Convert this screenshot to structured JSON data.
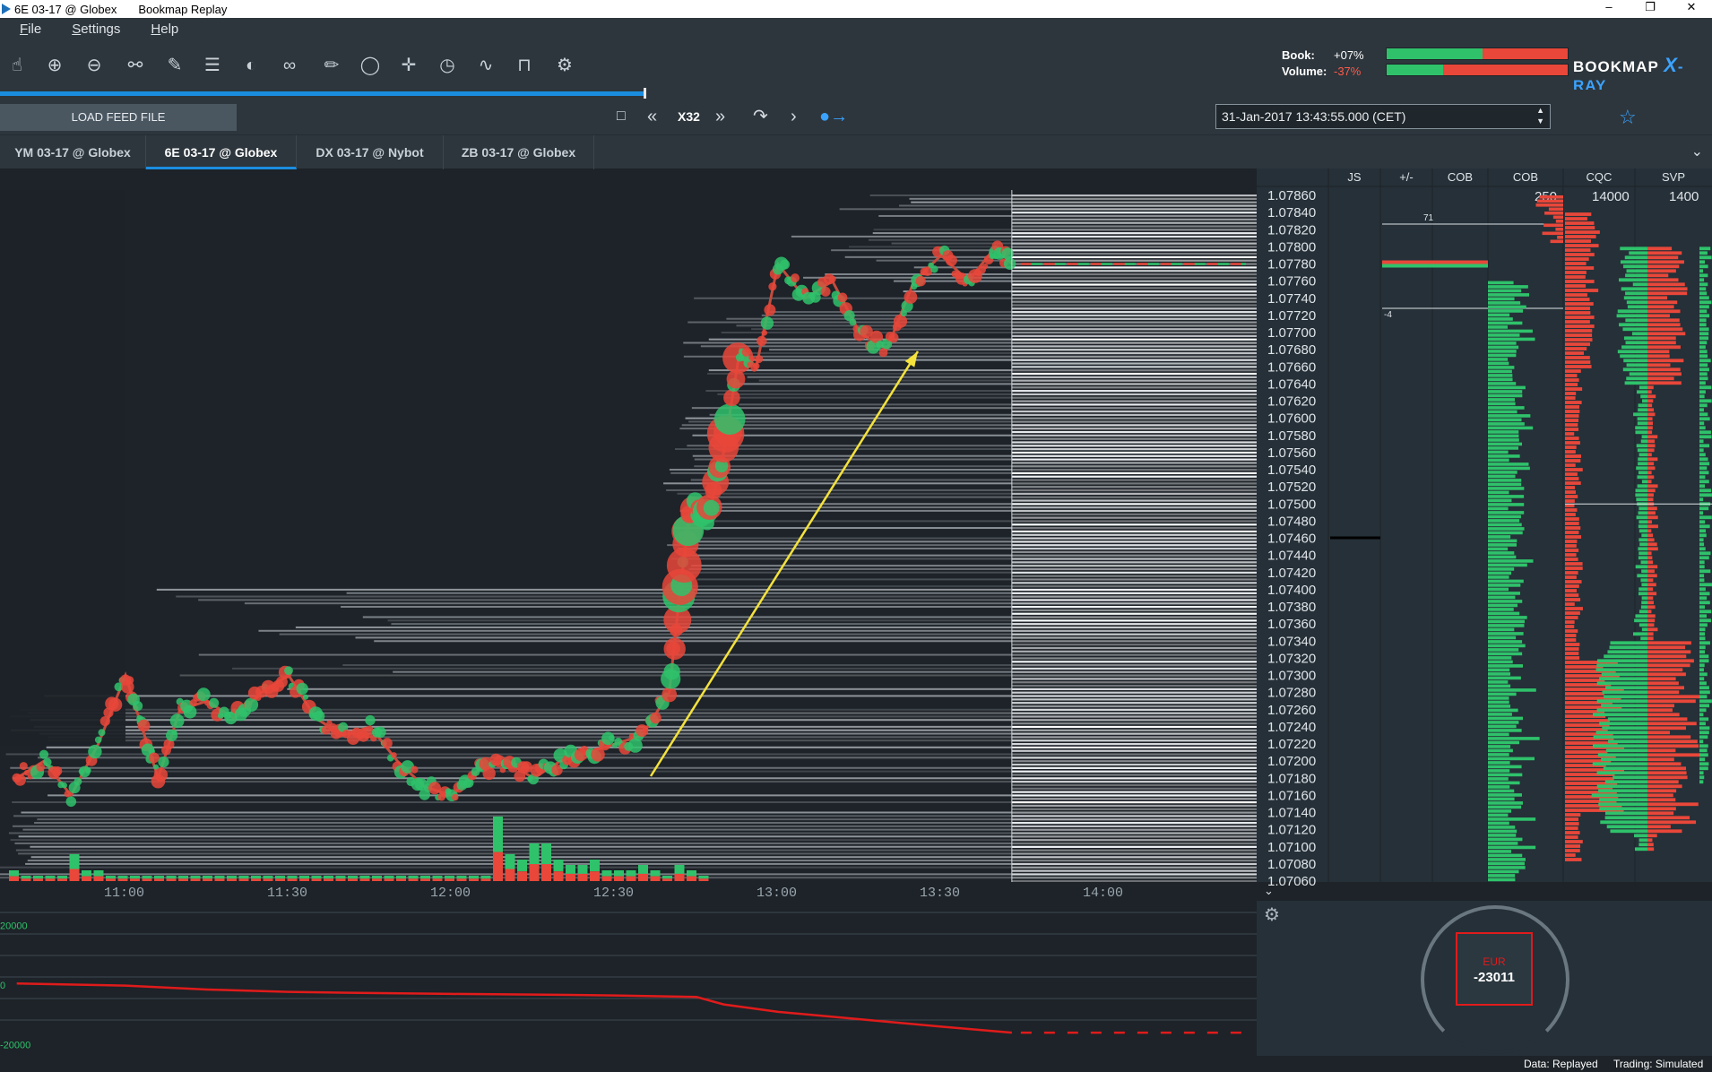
{
  "window": {
    "title": "6E 03-17 @ Globex",
    "app_name": "Bookmap Replay",
    "controls": [
      "–",
      "❐",
      "✕"
    ]
  },
  "menu": [
    "File",
    "Settings",
    "Help"
  ],
  "toolbar": {
    "icons": [
      "hand-icon",
      "zoom-in-icon",
      "zoom-out-icon",
      "share-icon",
      "probe-icon",
      "layers-icon",
      "brightness-icon",
      "link-icon",
      "pencil-icon",
      "chat-icon",
      "crosshair-icon",
      "stopwatch-icon",
      "strategy-icon",
      "lock-icon",
      "gear-icon"
    ],
    "book_label": "Book:",
    "book_value": "+07%",
    "volume_label": "Volume:",
    "volume_value": "-37%",
    "logo_text": "BOOKMAP",
    "logo_x": "X",
    "logo_ray": "-RAY",
    "colors": {
      "green": "#2fc26b",
      "red": "#e8473a",
      "blue": "#3aa3ff"
    }
  },
  "replay": {
    "progress": 0.377,
    "load_button": "LOAD FEED FILE",
    "speed": "X32",
    "datetime": "31-Jan-2017 13:43:55.000 (CET)"
  },
  "tabs": [
    {
      "label": "YM 03-17 @ Globex",
      "active": false
    },
    {
      "label": "6E 03-17 @ Globex",
      "active": true
    },
    {
      "label": "DX 03-17 @ Nybot",
      "active": false
    },
    {
      "label": "ZB 03-17 @ Globex",
      "active": false
    }
  ],
  "columns": {
    "headers": [
      "JS",
      "+/-",
      "COB",
      "COB",
      "CQC",
      "SVP"
    ],
    "scale_values": [
      "250",
      "14000",
      "1400"
    ],
    "cob_marks": [
      "71",
      "-4"
    ]
  },
  "chart_data": [
    {
      "type": "line",
      "title": "",
      "price_axis": [
        "1.07860",
        "1.07840",
        "1.07820",
        "1.07800",
        "1.07780",
        "1.07760",
        "1.07740",
        "1.07720",
        "1.07700",
        "1.07680",
        "1.07660",
        "1.07640",
        "1.07620",
        "1.07600",
        "1.07580",
        "1.07560",
        "1.07540",
        "1.07520",
        "1.07500",
        "1.07480",
        "1.07460",
        "1.07440",
        "1.07420",
        "1.07400",
        "1.07380",
        "1.07360",
        "1.07340",
        "1.07320",
        "1.07300",
        "1.07280",
        "1.07260",
        "1.07240",
        "1.07220",
        "1.07200",
        "1.07180",
        "1.07160",
        "1.07140",
        "1.07120",
        "1.07100",
        "1.07080",
        "1.07060"
      ],
      "time_axis": [
        "11:00",
        "11:30",
        "12:00",
        "12:30",
        "13:00",
        "13:30",
        "14:00"
      ],
      "ylim": [
        1.0706,
        1.0786
      ],
      "series": [
        {
          "values": [
            [
              "10:40",
              1.0718
            ],
            [
              "10:45",
              1.072
            ],
            [
              "10:50",
              1.0716
            ],
            [
              "10:55",
              1.0722
            ],
            [
              "11:00",
              1.073
            ],
            [
              "11:03",
              1.0724
            ],
            [
              "11:06",
              1.0718
            ],
            [
              "11:10",
              1.0726
            ],
            [
              "11:15",
              1.0727
            ],
            [
              "11:20",
              1.0725
            ],
            [
              "11:25",
              1.0728
            ],
            [
              "11:30",
              1.073
            ],
            [
              "11:35",
              1.0725
            ],
            [
              "11:40",
              1.0723
            ],
            [
              "11:45",
              1.0724
            ],
            [
              "11:50",
              1.072
            ],
            [
              "11:55",
              1.0717
            ],
            [
              "12:00",
              1.0716
            ],
            [
              "12:05",
              1.0719
            ],
            [
              "12:10",
              1.072
            ],
            [
              "12:15",
              1.0718
            ],
            [
              "12:20",
              1.072
            ],
            [
              "12:25",
              1.0721
            ],
            [
              "12:30",
              1.0722
            ],
            [
              "12:35",
              1.0723
            ],
            [
              "12:40",
              1.0728
            ],
            [
              "12:42",
              1.074
            ],
            [
              "12:44",
              1.075
            ],
            [
              "12:47",
              1.0748
            ],
            [
              "12:50",
              1.0756
            ],
            [
              "12:53",
              1.0768
            ],
            [
              "12:56",
              1.0766
            ],
            [
              "13:00",
              1.0778
            ],
            [
              "13:05",
              1.0774
            ],
            [
              "13:10",
              1.0776
            ],
            [
              "13:15",
              1.077
            ],
            [
              "13:20",
              1.0768
            ],
            [
              "13:25",
              1.0776
            ],
            [
              "13:30",
              1.0779
            ],
            [
              "13:35",
              1.0776
            ],
            [
              "13:40",
              1.078
            ],
            [
              "13:43",
              1.0778
            ]
          ]
        }
      ],
      "last_price": 1.0778,
      "marker_price": 1.0746,
      "volume_bars": [
        2,
        1,
        1,
        1,
        1,
        5,
        2,
        2,
        1,
        1,
        1,
        1,
        1,
        1,
        1,
        1,
        1,
        1,
        1,
        1,
        1,
        1,
        1,
        1,
        1,
        1,
        1,
        1,
        1,
        1,
        1,
        1,
        1,
        1,
        1,
        1,
        1,
        1,
        1,
        1,
        12,
        5,
        4,
        7,
        7,
        4,
        3,
        3,
        4,
        2,
        2,
        2,
        3,
        2,
        1,
        3,
        2,
        1
      ]
    },
    {
      "type": "line",
      "title": "",
      "y_ticks": [
        "20000",
        "0",
        "-20000"
      ],
      "ylim": [
        -22000,
        25000
      ],
      "series": [
        {
          "values": [
            [
              "10:40",
              500
            ],
            [
              "11:00",
              -200
            ],
            [
              "11:15",
              -1500
            ],
            [
              "11:30",
              -2300
            ],
            [
              "11:45",
              -2700
            ],
            [
              "12:00",
              -3000
            ],
            [
              "12:15",
              -3200
            ],
            [
              "12:30",
              -3500
            ],
            [
              "12:45",
              -4000
            ],
            [
              "12:50",
              -6500
            ],
            [
              "13:00",
              -9000
            ],
            [
              "13:15",
              -11500
            ],
            [
              "13:30",
              -14000
            ],
            [
              "13:43",
              -16000
            ]
          ]
        }
      ]
    }
  ],
  "position": {
    "currency": "EUR",
    "value": "-23011"
  },
  "status": {
    "data": "Data: Replayed",
    "trading": "Trading: Simulated"
  }
}
